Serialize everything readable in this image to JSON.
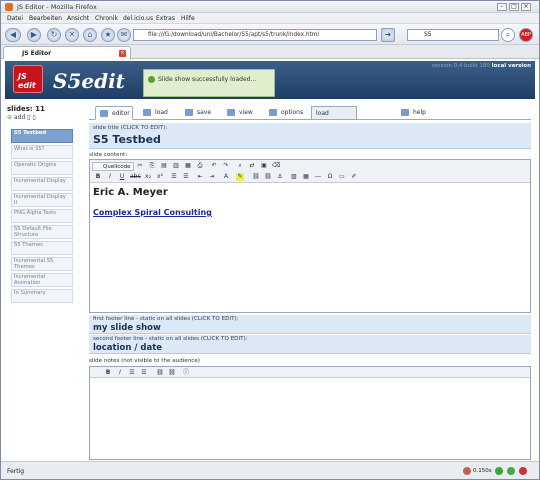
{
  "window": {
    "title": "JS Editor - Mozilla Firefox"
  },
  "menu": [
    "Datei",
    "Bearbeiten",
    "Ansicht",
    "Chronik",
    "del.icio.us",
    "Extras",
    "Hilfe"
  ],
  "nav": {
    "url": "file:///G:/download/uni/Bachelor/S5/apt/s5/trunk/index.html",
    "search_value": "S5"
  },
  "tab": {
    "label": "JS Editor"
  },
  "banner": {
    "logo_text": "JS edit",
    "brand": "S5edit",
    "notice": "Slide show successfully loaded...",
    "version_prefix": "version 0.4 build 180",
    "version_suffix": "local version"
  },
  "sidebar": {
    "heading": "slides: 11",
    "add_label": "add",
    "slides": [
      "S5 Testbed",
      "What is S5?",
      "Operatic Origins",
      "Incremental Display",
      "Incremental Display II",
      "PNG Alpha Tests",
      "S5 Default File Structure",
      "S5 Themes",
      "Incremental S5 Themes",
      "Incremental Animation",
      "In Summary"
    ]
  },
  "tabs": {
    "editor": "editor",
    "load": "load",
    "save": "save",
    "view": "view",
    "options": "options",
    "load_example": "load example",
    "help": "help"
  },
  "slide": {
    "title_label": "slide title (CLICK TO EDIT):",
    "title": "S5 Testbed",
    "content_label": "slide content:",
    "quellcode": "Quellcode",
    "author": "Eric A. Meyer",
    "link": "Complex Spiral Consulting",
    "footer1_label": "first footer line - static on all slides (CLICK TO EDIT):",
    "footer1": "my slide show",
    "footer2_label": "second footer line - static on all slides (CLICK TO EDIT):",
    "footer2": "location / date",
    "notes_label": "slide notes (not visible to the audience)"
  },
  "status": {
    "text": "Fertig",
    "time": "0.150s"
  },
  "colors": {
    "banner": "#2c4d76",
    "selected_slide": "#7ea0cc",
    "field_bg": "#dce8f6",
    "title_text": "#1c3256"
  }
}
